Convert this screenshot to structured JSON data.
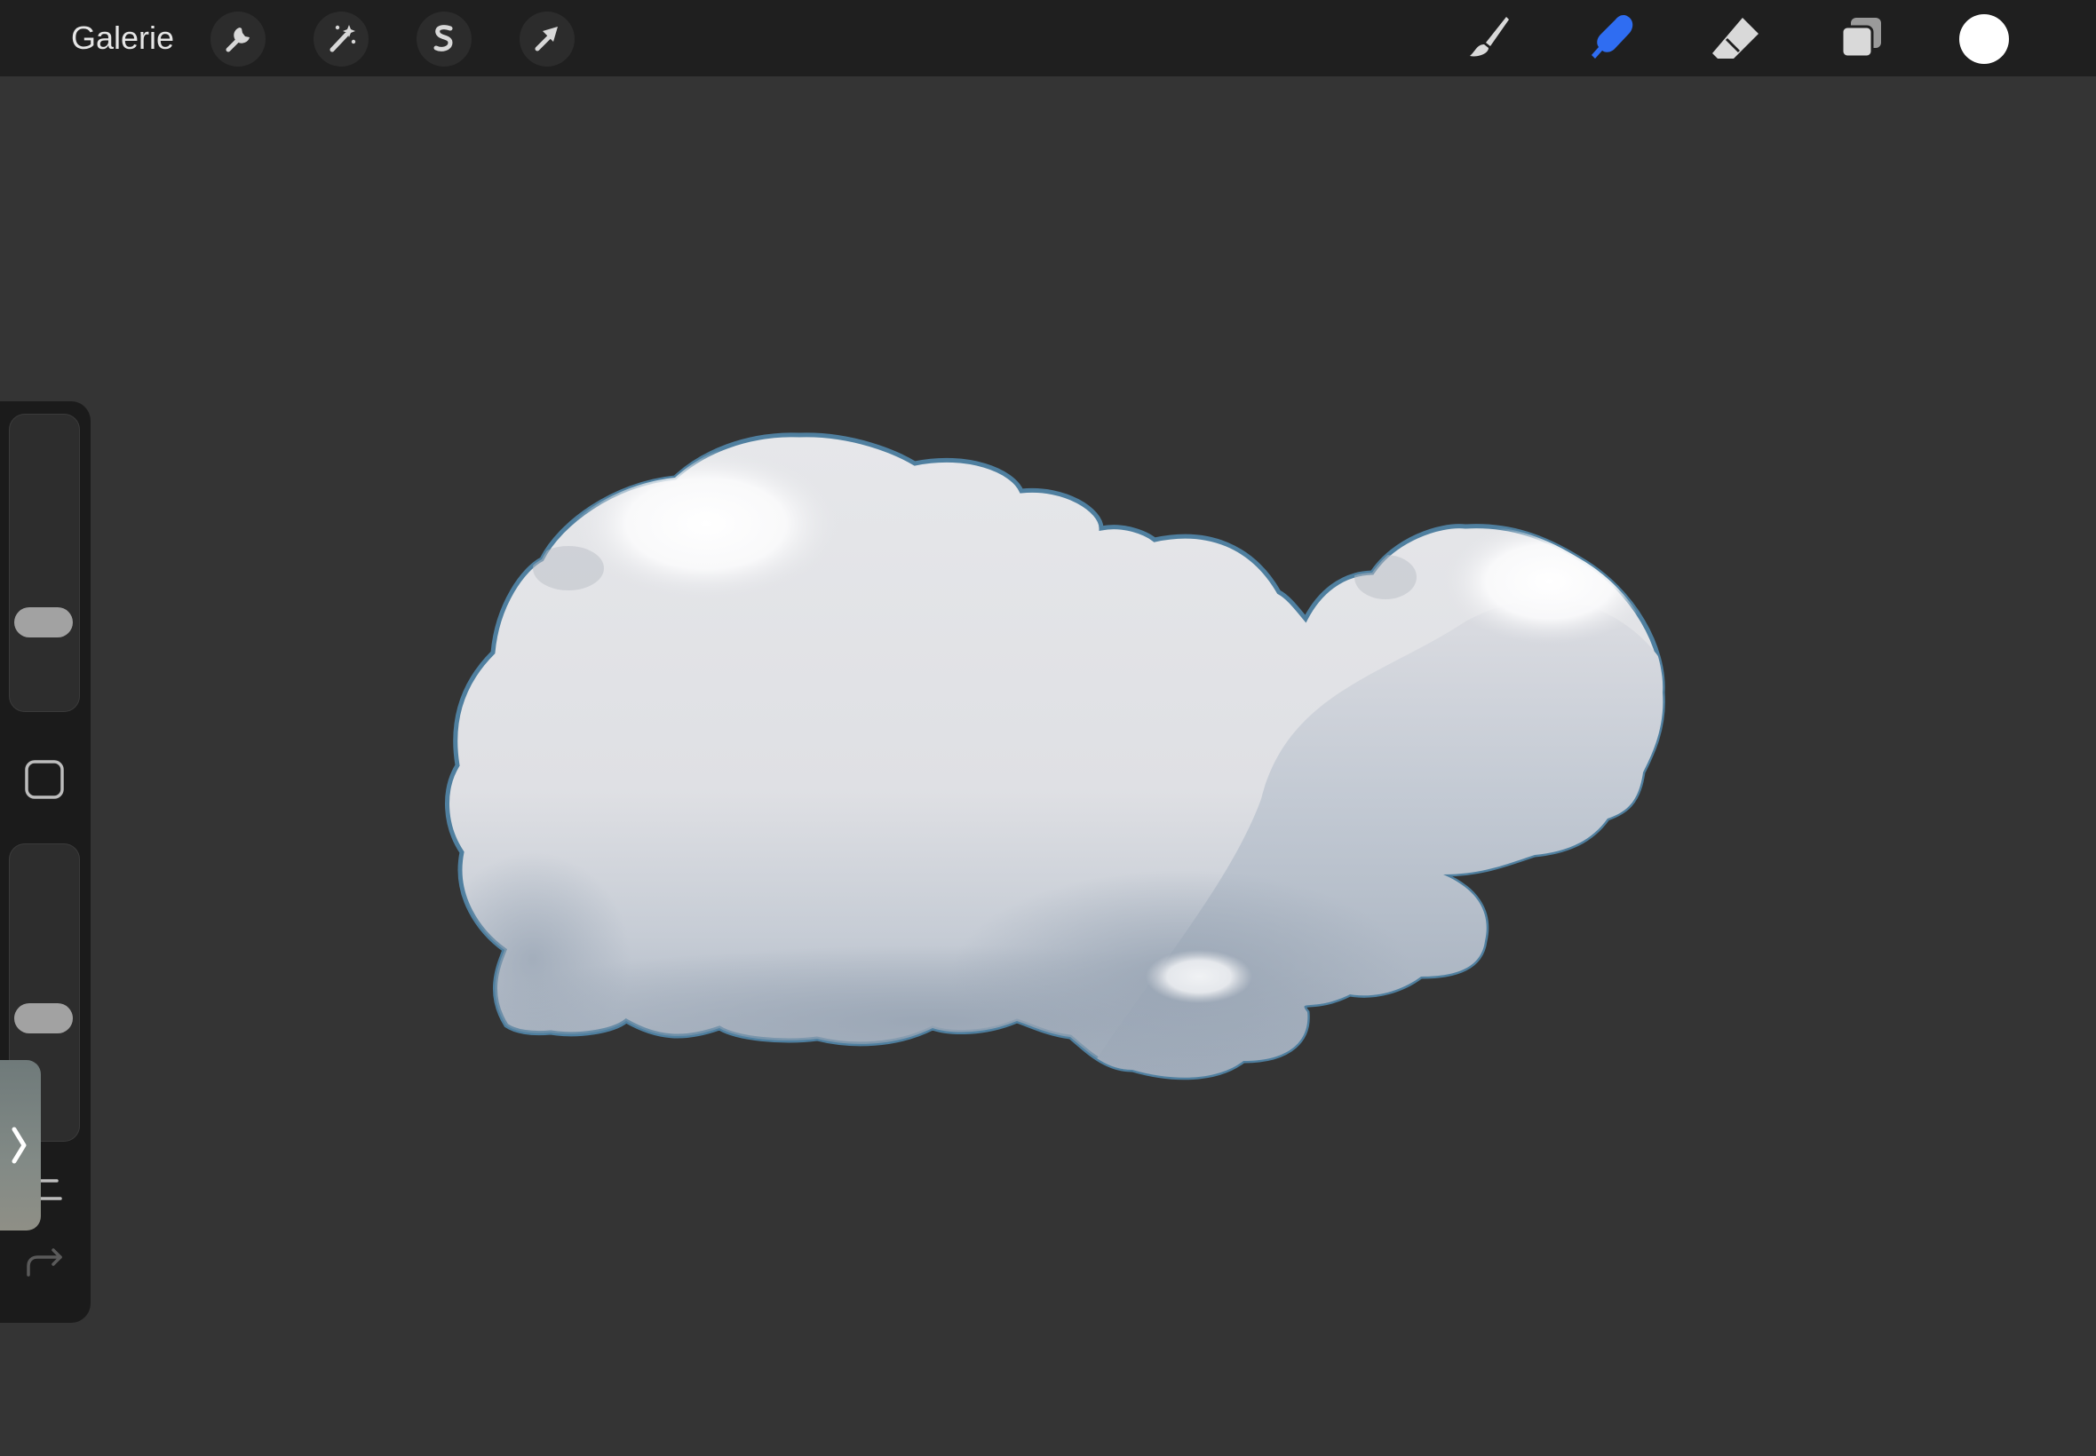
{
  "topbar": {
    "gallery_label": "Galerie",
    "left_tools": [
      {
        "name": "actions",
        "icon": "wrench-icon"
      },
      {
        "name": "adjustments",
        "icon": "magic-wand-icon"
      },
      {
        "name": "selection",
        "icon": "selection-s-icon"
      },
      {
        "name": "transform",
        "icon": "arrow-cursor-icon"
      }
    ],
    "right_tools": [
      {
        "name": "paint",
        "icon": "brush-icon",
        "active": false
      },
      {
        "name": "smudge",
        "icon": "smudge-finger-icon",
        "active": true
      },
      {
        "name": "erase",
        "icon": "eraser-icon",
        "active": false
      },
      {
        "name": "layers",
        "icon": "layers-icon",
        "active": false
      }
    ],
    "current_color": "#ffffff",
    "active_color": "#2f6df2"
  },
  "sidebar": {
    "brush_size_level": 0.27,
    "opacity_level": 0.4,
    "modifier_icon": "square-modifier-icon",
    "undo_icon": "undo-arrow-icon",
    "redo_icon": "redo-arrow-icon",
    "collapse_icon": "chevron-right-icon"
  },
  "canvas": {
    "background": "#343434",
    "artwork": "cloud-drawing",
    "outline_color": "#4f7f9f",
    "light_color": "#e2e3e6",
    "shadow_color": "#9da9b7",
    "highlight_color": "#ffffff"
  }
}
